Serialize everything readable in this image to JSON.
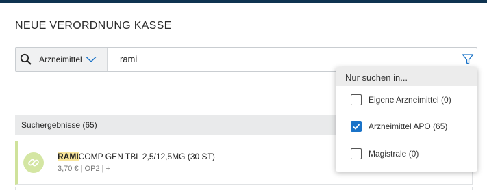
{
  "header": {
    "title": "NEUE VERORDNUNG KASSE"
  },
  "search": {
    "scope_label": "Arzneimittel",
    "query": "rami"
  },
  "filter_menu": {
    "title": "Nur suchen in...",
    "options": [
      {
        "label": "Eigene Arzneimittel (0)",
        "checked": false
      },
      {
        "label": "Arzneimittel APO (65)",
        "checked": true
      },
      {
        "label": "Magistrale (0)",
        "checked": false
      }
    ]
  },
  "results": {
    "header": "Suchergebnisse (65)",
    "items": [
      {
        "highlight": "RAMI",
        "name_rest": "COMP GEN TBL 2,5/12,5MG (30 ST)",
        "meta": "3,70 € | OP2 | +"
      }
    ]
  },
  "colors": {
    "topbar": "#0f3350",
    "accent": "#1a73c8",
    "badge": "#d4e6a3",
    "highlight": "#f9e59a"
  }
}
